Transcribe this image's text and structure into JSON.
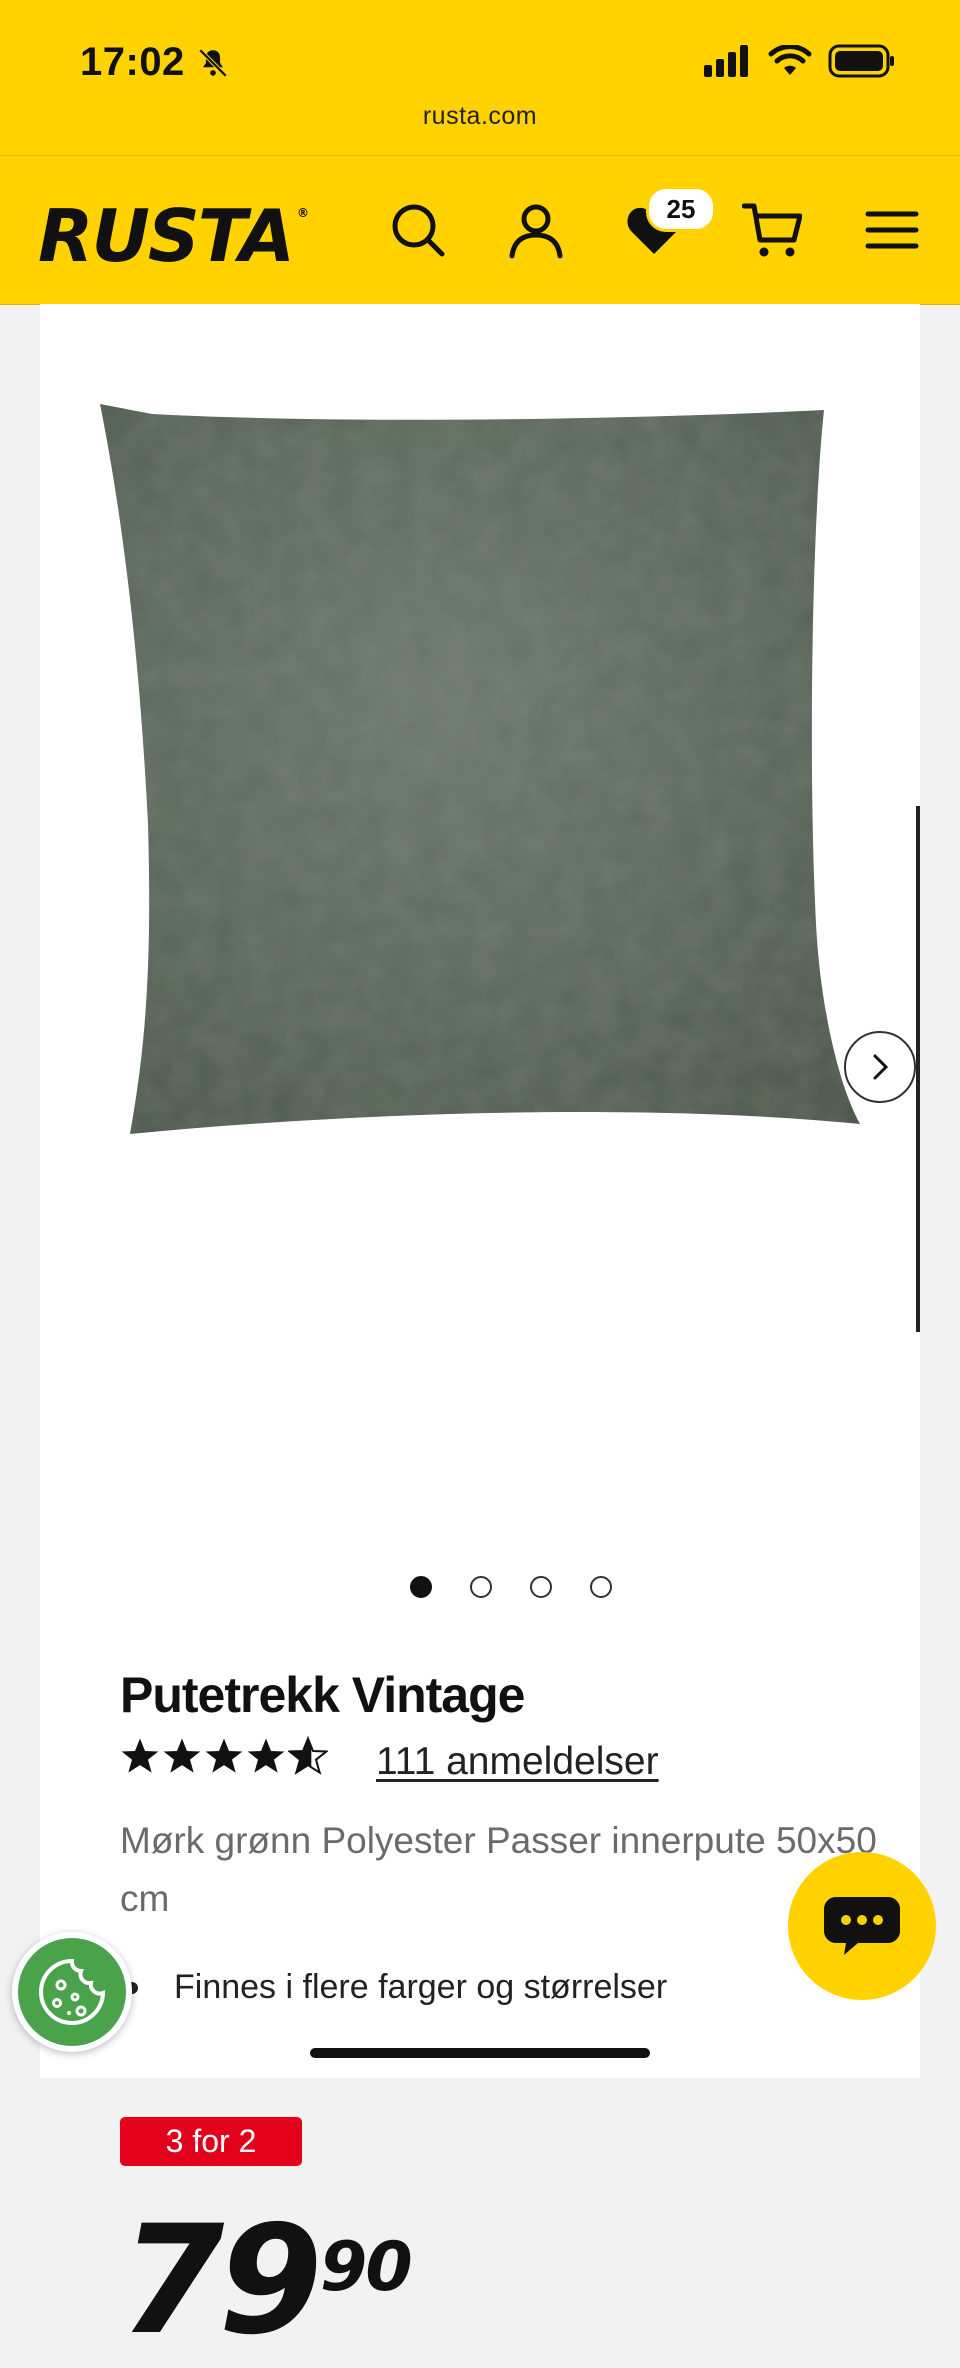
{
  "status": {
    "time": "17:02",
    "url": "rusta.com"
  },
  "header": {
    "logo": "RUSTA",
    "wishlist_count": "25"
  },
  "product": {
    "title": "Putetrekk Vintage",
    "rating": 4.5,
    "reviews_label": "111 anmeldelser",
    "description": "Mørk grønn Polyester Passer innerpute 50x50 cm",
    "bullets": [
      "Finnes i flere farger og størrelser"
    ],
    "promo_badge": "3 for 2",
    "price_main": "79",
    "price_decimals": "90",
    "gallery": {
      "total_images": 4,
      "active_index": 0
    }
  },
  "colors": {
    "brand_yellow": "#ffd200",
    "promo_red": "#e2001a",
    "cookie_green": "#4aa34a",
    "product_green": "#5e6b5e"
  }
}
